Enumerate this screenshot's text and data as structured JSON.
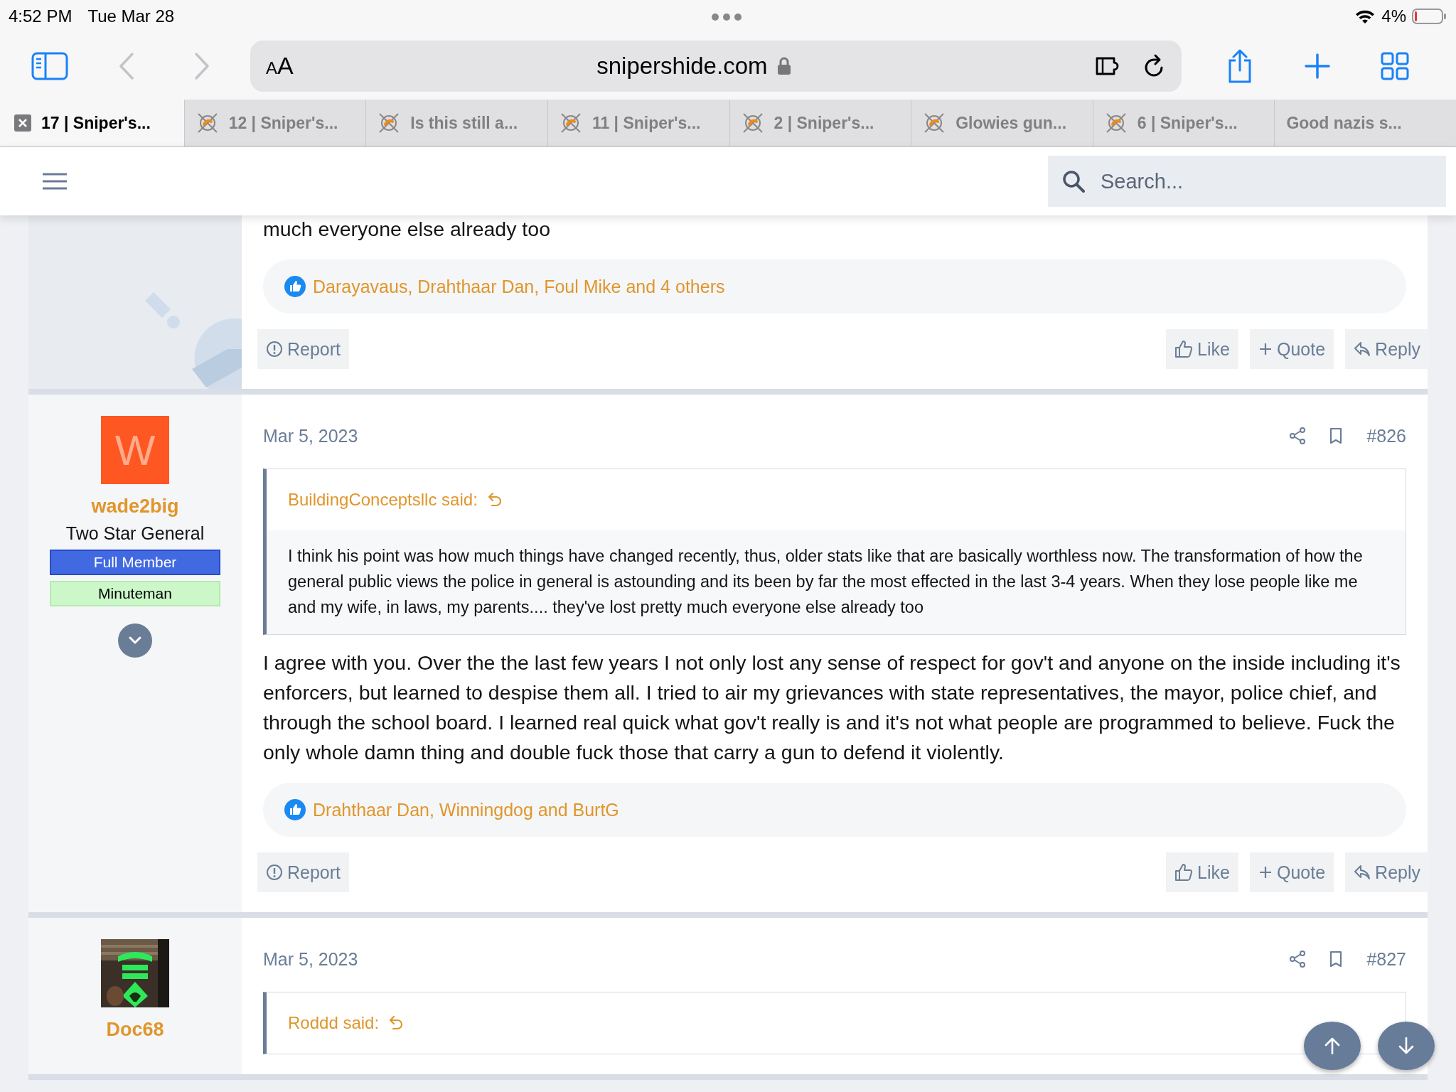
{
  "status_bar": {
    "time": "4:52 PM",
    "date": "Tue Mar 28",
    "battery": "4%"
  },
  "toolbar": {
    "text_size": "AA",
    "url": "snipershide.com",
    "back": {
      "disabled": true
    },
    "forward": {
      "disabled": true
    }
  },
  "tabs": [
    {
      "label": "17 | Sniper's...",
      "selected": true,
      "favicon": false
    },
    {
      "label": "12 | Sniper's...",
      "selected": false,
      "favicon": true
    },
    {
      "label": "Is this still a...",
      "selected": false,
      "favicon": true
    },
    {
      "label": "11 | Sniper's...",
      "selected": false,
      "favicon": true
    },
    {
      "label": "2 | Sniper's...",
      "selected": false,
      "favicon": true
    },
    {
      "label": "Glowies gun...",
      "selected": false,
      "favicon": true
    },
    {
      "label": "6 | Sniper's...",
      "selected": false,
      "favicon": true
    },
    {
      "label": "Good nazis s...",
      "selected": false,
      "favicon": false
    }
  ],
  "search": {
    "placeholder": "Search..."
  },
  "posts": [
    {
      "body": "much everyone else already too",
      "reactions": "Darayavaus, Drahthaar Dan, Foul Mike and 4 others",
      "report": "Report",
      "actions": [
        {
          "kind": "like",
          "label": "Like"
        },
        {
          "kind": "quote",
          "label": "Quote"
        },
        {
          "kind": "reply",
          "label": "Reply"
        }
      ]
    },
    {
      "user": {
        "avatar": {
          "kind": "letter",
          "letter": "W"
        },
        "name": "wade2big",
        "title": "Two Star General",
        "banners": [
          {
            "kind": "member",
            "label": "Full Member"
          },
          {
            "kind": "minuteman",
            "label": "Minuteman"
          }
        ],
        "expandable": true
      },
      "date": "Mar 5, 2023",
      "number": "#826",
      "quote": {
        "author": "BuildingConceptsllc said:",
        "text": "I think his point was how much things have changed recently, thus, older stats like that are basically worthless now. The transformation of how the general public views the police in general is astounding and its been by far the most effected in the last 3-4 years. When they lose people like me and my wife, in laws, my parents.... they've lost pretty much everyone else already too"
      },
      "body": "I agree with you. Over the the last few years I not only lost any sense of respect for gov't and anyone on the inside including it's enforcers, but learned to despise them all. I tried to air my grievances with state representatives, the mayor, police chief, and through the school board. I learned real quick what gov't really is and it's not what people are programmed to believe. Fuck the only whole damn thing and double fuck those that carry a gun to defend it violently.",
      "reactions": "Drahthaar Dan, Winningdog and BurtG",
      "report": "Report",
      "actions": [
        {
          "kind": "like",
          "label": "Like"
        },
        {
          "kind": "quote",
          "label": "Quote"
        },
        {
          "kind": "reply",
          "label": "Reply"
        }
      ]
    },
    {
      "user": {
        "name": "Doc68"
      },
      "date": "Mar 5, 2023",
      "number": "#827",
      "quote": {
        "author": "Roddd said:"
      }
    }
  ]
}
